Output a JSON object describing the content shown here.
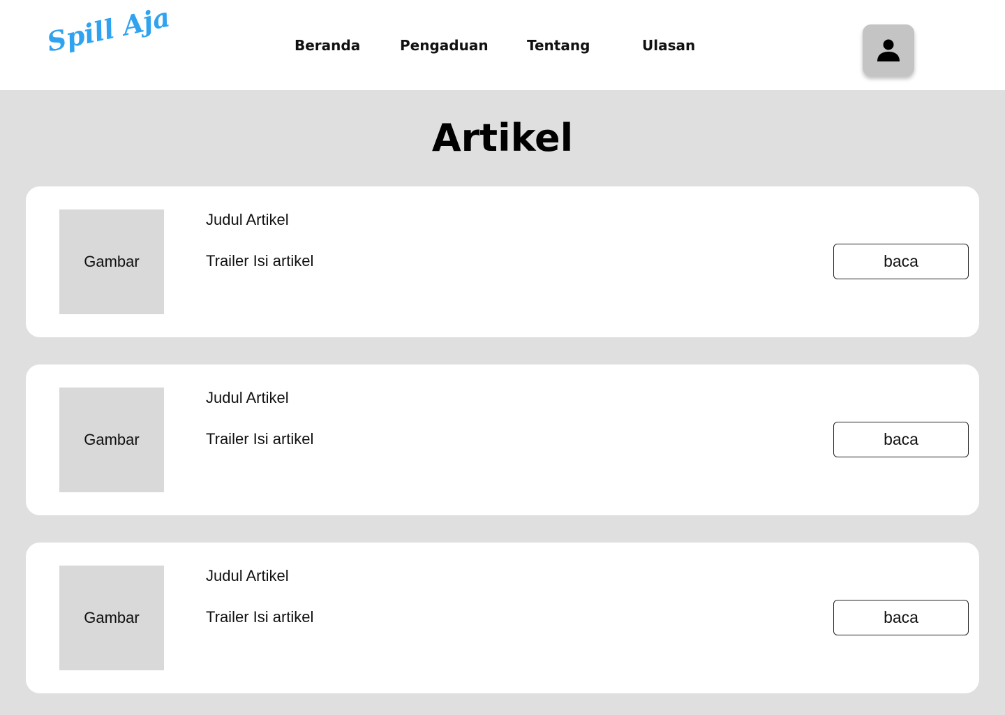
{
  "header": {
    "logo_text": "Spill Aja",
    "logo_color": "#2fa3f0",
    "nav": [
      {
        "label": "Beranda"
      },
      {
        "label": "Pengaduan"
      },
      {
        "label": "Tentang"
      },
      {
        "label": "Ulasan"
      }
    ],
    "profile_icon": "user-icon"
  },
  "main": {
    "title": "Artikel",
    "articles": [
      {
        "image_label": "Gambar",
        "title": "Judul Artikel",
        "trailer": "Trailer Isi artikel",
        "button_label": "baca"
      },
      {
        "image_label": "Gambar",
        "title": "Judul Artikel",
        "trailer": "Trailer Isi artikel",
        "button_label": "baca"
      },
      {
        "image_label": "Gambar",
        "title": "Judul Artikel",
        "trailer": "Trailer Isi artikel",
        "button_label": "baca"
      }
    ]
  },
  "colors": {
    "page_background": "#dfdfdf",
    "card_background": "#ffffff",
    "image_placeholder": "#d9d9d9",
    "avatar_background": "#c4c4c4"
  }
}
